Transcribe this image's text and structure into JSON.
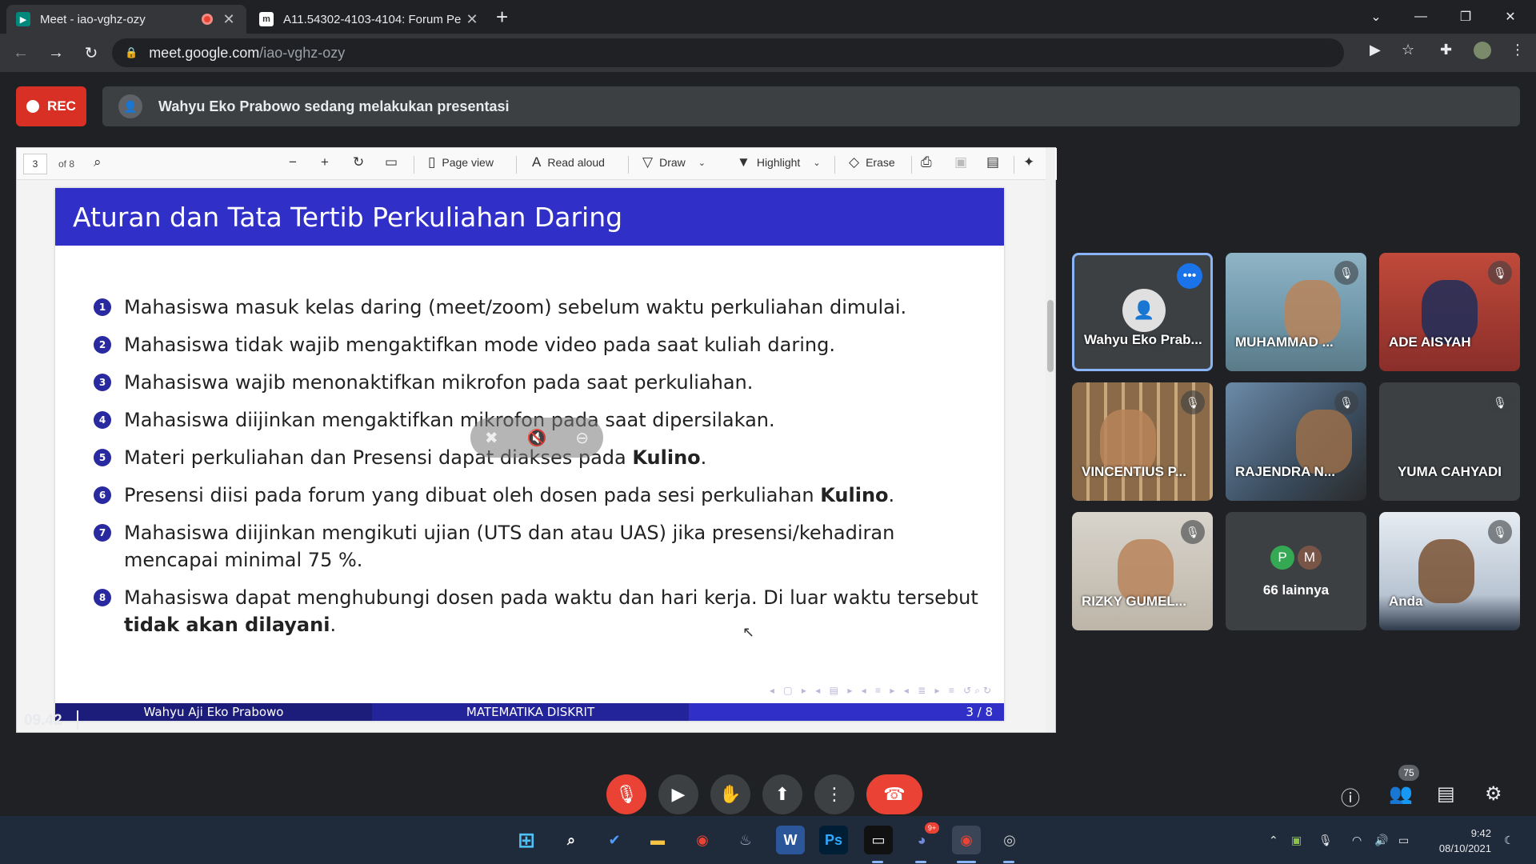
{
  "browser": {
    "tabs": [
      {
        "title": "Meet - iao-vghz-ozy",
        "close": "✕"
      },
      {
        "title": "A11.54302-4103-4104: Forum Pe",
        "close": "✕"
      }
    ],
    "new_tab": "+",
    "url_host": "meet.google.com",
    "url_path": "/iao-vghz-ozy"
  },
  "meet": {
    "rec_label": "REC",
    "presenter_text": "Wahyu Eko Prabowo sedang melakukan presentasi",
    "time": "09.42",
    "participant_count": "75"
  },
  "pdf": {
    "page": "3",
    "of": "of 8",
    "tools": {
      "page_view": "Page view",
      "read_aloud": "Read aloud",
      "draw": "Draw",
      "highlight": "Highlight",
      "erase": "Erase"
    }
  },
  "slide": {
    "title": "Aturan dan Tata Tertib Perkuliahan Daring",
    "items": [
      {
        "num": "1",
        "text": "Mahasiswa masuk kelas daring (meet/zoom) sebelum waktu perkuliahan dimulai.",
        "bold": ""
      },
      {
        "num": "2",
        "text": "Mahasiswa tidak wajib mengaktifkan mode video pada saat kuliah daring.",
        "bold": ""
      },
      {
        "num": "3",
        "text": "Mahasiswa wajib menonaktifkan mikrofon pada saat perkuliahan.",
        "bold": ""
      },
      {
        "num": "4",
        "text": "Mahasiswa diijinkan mengaktifkan mikrofon pada saat dipersilakan.",
        "bold": ""
      },
      {
        "num": "5",
        "text": "Materi perkuliahan dan Presensi dapat diakses pada ",
        "bold": "Kulino",
        "tail": "."
      },
      {
        "num": "6",
        "text": "Presensi diisi pada forum yang dibuat oleh dosen pada sesi perkuliahan ",
        "bold": "Kulino",
        "tail": "."
      },
      {
        "num": "7",
        "text": "Mahasiswa diijinkan mengikuti ujian (UTS dan atau UAS) jika presensi/kehadiran mencapai minimal 75 %.",
        "bold": ""
      },
      {
        "num": "8",
        "text": "Mahasiswa dapat menghubungi dosen pada waktu dan hari kerja. Di luar waktu tersebut ",
        "bold": "tidak akan dilayani",
        "tail": "."
      }
    ],
    "footer_author": "Wahyu Aji Eko Prabowo",
    "footer_course": "MATEMATIKA DISKRIT",
    "footer_page": "3 / 8"
  },
  "participants": [
    {
      "name": "Wahyu Eko Prab..."
    },
    {
      "name": "MUHAMMAD ..."
    },
    {
      "name": "ADE AISYAH"
    },
    {
      "name": "VINCENTIUS P..."
    },
    {
      "name": "RAJENDRA N..."
    },
    {
      "name": "YUMA CAHYADI"
    },
    {
      "name": "RIZKY GUMEL..."
    },
    {
      "name": "66 lainnya",
      "initials": [
        "P",
        "M"
      ]
    },
    {
      "name": "Anda"
    }
  ],
  "taskbar": {
    "clock_time": "9:42",
    "clock_date": "08/10/2021",
    "discord_badge": "9+"
  },
  "colors": {
    "slide_title_bg": "#3030c8",
    "rec_red": "#d93025",
    "active_tile_border": "#8ab4f8"
  }
}
